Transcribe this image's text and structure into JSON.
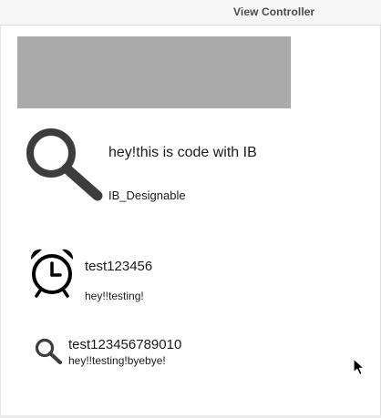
{
  "window": {
    "title": "View Controller"
  },
  "cell1": {
    "icon": "search-icon",
    "title": "hey!this is code with IB",
    "subtitle": "IB_Designable"
  },
  "cell2": {
    "icon": "alarm-clock-icon",
    "title": "test123456",
    "subtitle": "hey!!testing!"
  },
  "cell3": {
    "icon": "search-icon",
    "title": "test123456789010",
    "subtitle": "hey!!testing!byebye!"
  },
  "colors": {
    "placeholder_gray": "#aaaaaa",
    "icon_dark": "#3d3d3d"
  }
}
